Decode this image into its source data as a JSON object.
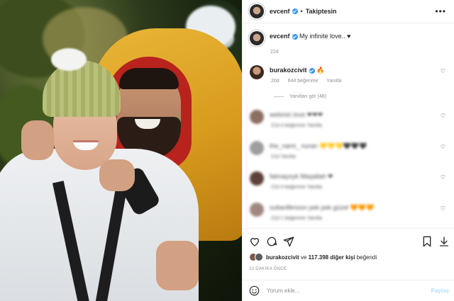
{
  "post": {
    "author": "evcenf",
    "follow_status": "Takiptesin",
    "more_icon": "ellipsis-icon"
  },
  "caption": {
    "username": "evcenf",
    "text": "My infinite love.. ♥",
    "time": "22d"
  },
  "comments": [
    {
      "username": "burakozcivit",
      "text": "🔥",
      "time": "20d",
      "likes": "644 beğenme",
      "reply": "Yanıtla",
      "view_replies": "Yanıtları gör (48)",
      "avatar_color": "#7b5a45"
    },
    {
      "blurred_text": "webmin love ❤❤❤",
      "blurred_meta": "21d 4 beğenme Yanıtla",
      "avatar_color": "#8d6e63"
    },
    {
      "blurred_text": "the_nami_ nuran 💛💛💛🖤🖤🖤",
      "blurred_meta": "21d Yanıtla",
      "avatar_color": "#9e9e9e"
    },
    {
      "blurred_text": "fatmayoyk Maşallah ❤",
      "blurred_meta": "21d 4 beğenme Yanıtla",
      "avatar_color": "#5d4037"
    },
    {
      "blurred_text": "sultanfiknoon pek pek güzel 🧡🧡🧡",
      "blurred_meta": "21d 1 beğenme Yanıtla",
      "avatar_color": "#a1887f"
    }
  ],
  "likes": {
    "user": "burakozcivit",
    "connector": "ve",
    "count": "117.398",
    "suffix": "diğer kişi",
    "verb": "beğendi"
  },
  "posted_ago": "22 DAKİKA ÖNCE",
  "add_comment": {
    "placeholder": "Yorum ekle...",
    "submit": "Paylaş"
  },
  "colors": {
    "verified": "#3897f0",
    "share_disabled": "#b2dffc",
    "meta_gray": "#8e8e8e"
  }
}
